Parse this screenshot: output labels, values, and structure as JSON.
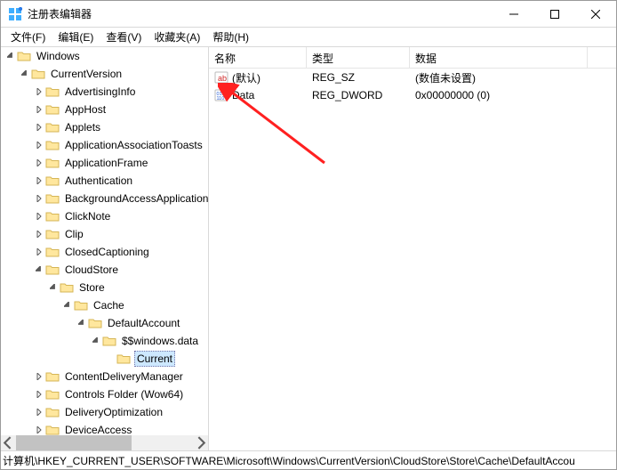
{
  "title": "注册表编辑器",
  "menu": {
    "file": "文件(F)",
    "edit": "编辑(E)",
    "view": "查看(V)",
    "favorites": "收藏夹(A)",
    "help": "帮助(H)"
  },
  "tree": {
    "root": "Windows",
    "children": [
      {
        "label": "CurrentVersion",
        "expanded": true,
        "children": [
          {
            "label": "AdvertisingInfo"
          },
          {
            "label": "AppHost"
          },
          {
            "label": "Applets"
          },
          {
            "label": "ApplicationAssociationToasts"
          },
          {
            "label": "ApplicationFrame"
          },
          {
            "label": "Authentication"
          },
          {
            "label": "BackgroundAccessApplications"
          },
          {
            "label": "ClickNote"
          },
          {
            "label": "Clip"
          },
          {
            "label": "ClosedCaptioning"
          },
          {
            "label": "CloudStore",
            "expanded": true,
            "children": [
              {
                "label": "Store",
                "expanded": true,
                "children": [
                  {
                    "label": "Cache",
                    "expanded": true,
                    "children": [
                      {
                        "label": "DefaultAccount",
                        "expanded": true,
                        "children": [
                          {
                            "label": "$$windows.data",
                            "expanded": true,
                            "children": [
                              {
                                "label": "Current",
                                "selected": true
                              }
                            ]
                          }
                        ]
                      }
                    ]
                  }
                ]
              }
            ]
          },
          {
            "label": "ContentDeliveryManager"
          },
          {
            "label": "Controls Folder (Wow64)"
          },
          {
            "label": "DeliveryOptimization"
          },
          {
            "label": "DeviceAccess"
          }
        ]
      }
    ]
  },
  "columns": {
    "name": "名称",
    "type": "类型",
    "data": "数据"
  },
  "values": [
    {
      "icon": "string",
      "name": "(默认)",
      "type": "REG_SZ",
      "data": "(数值未设置)"
    },
    {
      "icon": "binary",
      "name": "Data",
      "type": "REG_DWORD",
      "data": "0x00000000 (0)"
    }
  ],
  "statusbar": "计算机\\HKEY_CURRENT_USER\\SOFTWARE\\Microsoft\\Windows\\CurrentVersion\\CloudStore\\Store\\Cache\\DefaultAccou",
  "col_widths": {
    "name": 110,
    "type": 116,
    "data": 200
  }
}
